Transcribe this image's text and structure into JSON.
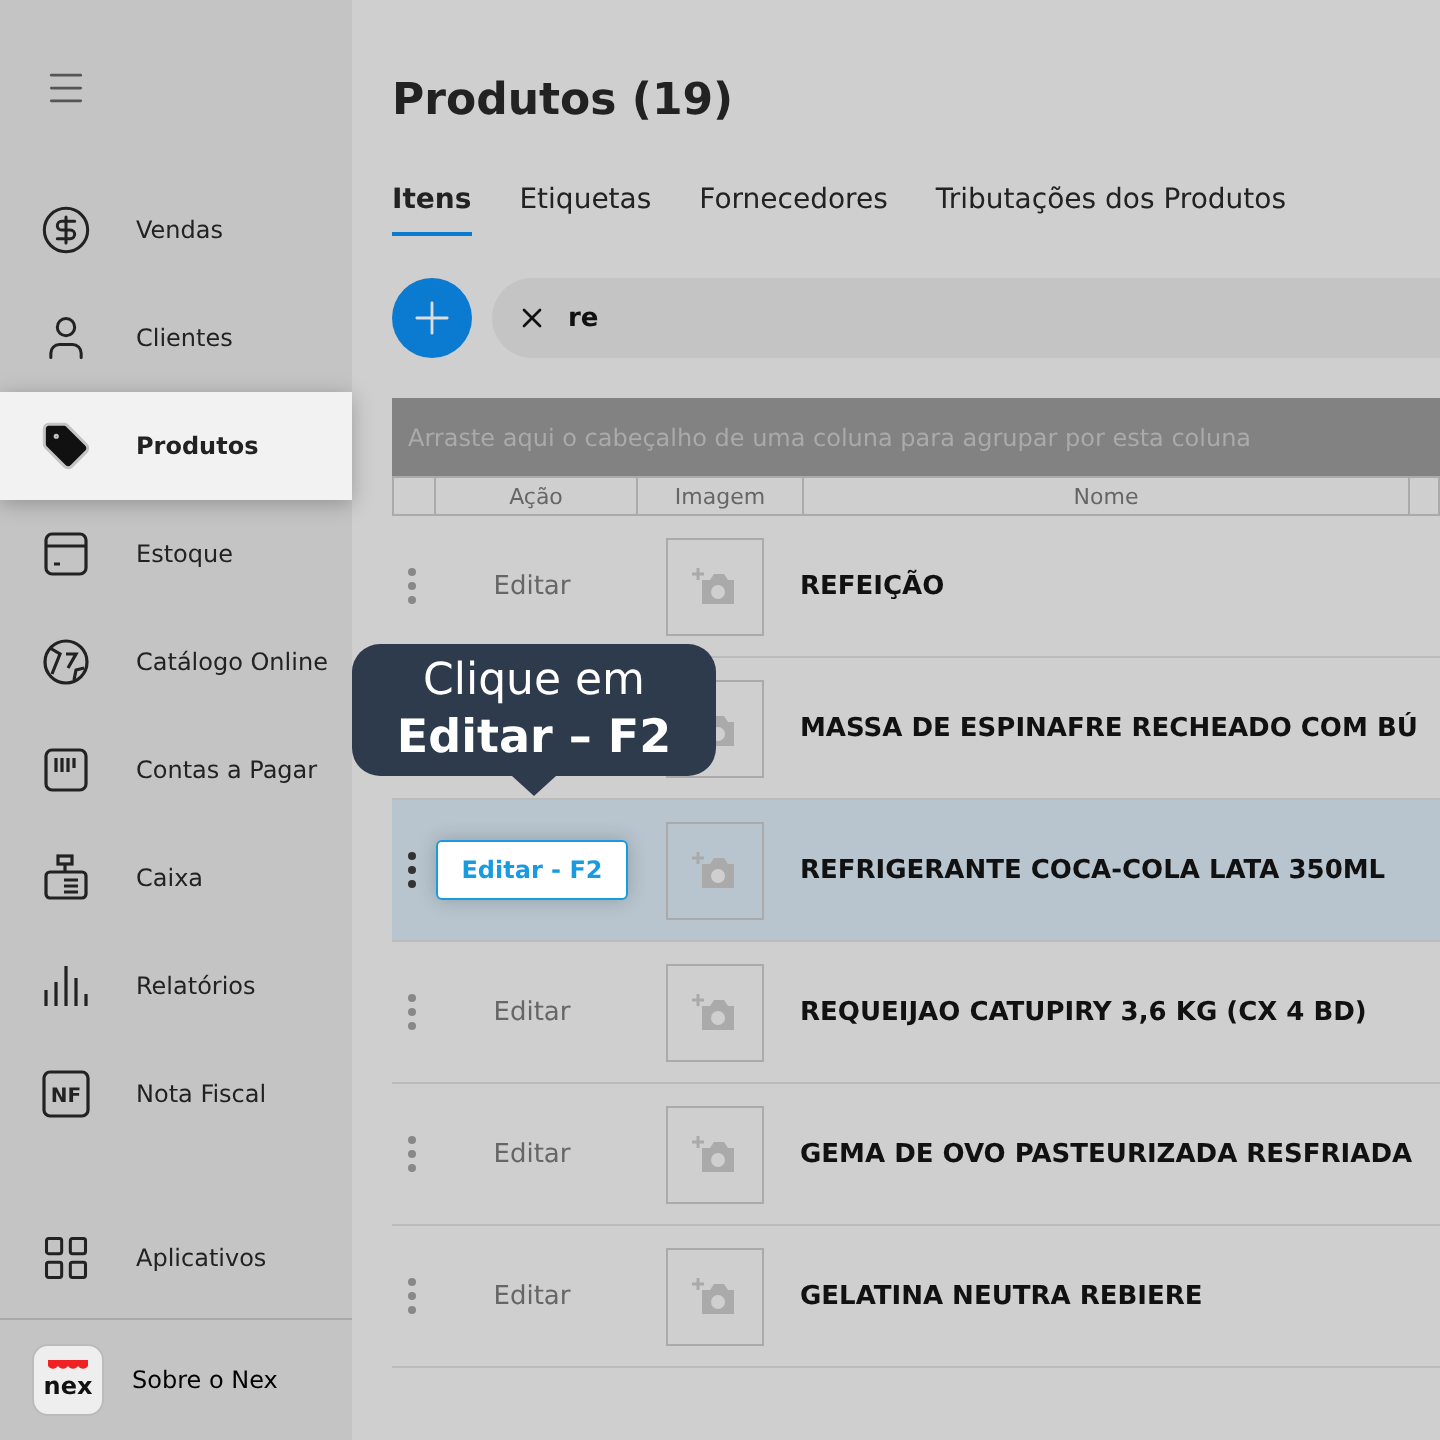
{
  "sidebar": {
    "items": [
      {
        "label": "Vendas",
        "selected": false
      },
      {
        "label": "Clientes",
        "selected": false
      },
      {
        "label": "Produtos",
        "selected": true
      },
      {
        "label": "Estoque",
        "selected": false
      },
      {
        "label": "Catálogo Online",
        "selected": false
      },
      {
        "label": "Contas a Pagar",
        "selected": false
      },
      {
        "label": "Caixa",
        "selected": false
      },
      {
        "label": "Relatórios",
        "selected": false
      },
      {
        "label": "Nota Fiscal",
        "icon_text": "NF",
        "selected": false
      }
    ],
    "apps": {
      "label": "Aplicativos"
    },
    "about": {
      "label": "Sobre o Nex",
      "logo_text": "nex"
    }
  },
  "page": {
    "title": "Produtos (19)"
  },
  "tabs": [
    {
      "label": "Itens",
      "selected": true
    },
    {
      "label": "Etiquetas",
      "selected": false
    },
    {
      "label": "Fornecedores",
      "selected": false
    },
    {
      "label": "Tributações dos Produtos",
      "selected": false
    }
  ],
  "search": {
    "value": "re"
  },
  "group_panel": {
    "text": "Arraste aqui o cabeçalho de uma coluna para agrupar por esta coluna"
  },
  "table": {
    "columns": [
      "Ação",
      "Imagem",
      "Nome"
    ],
    "rows": [
      {
        "action": "Editar",
        "name": "REFEIÇÃO",
        "selected": false
      },
      {
        "name": "MASSA DE ESPINAFRE RECHEADO COM BÚ",
        "selected": false
      },
      {
        "action": "Editar - F2",
        "name": "REFRIGERANTE COCA-COLA LATA 350ML",
        "selected": true
      },
      {
        "action": "Editar",
        "name": "REQUEIJAO CATUPIRY 3,6 KG (CX 4 BD)",
        "selected": false
      },
      {
        "action": "Editar",
        "name": "GEMA DE OVO PASTEURIZADA RESFRIADA",
        "selected": false
      },
      {
        "action": "Editar",
        "name": "GELATINA NEUTRA REBIERE",
        "selected": false
      }
    ]
  },
  "tooltip": {
    "line_1": "Clique em",
    "line_2": "Editar – F2"
  }
}
